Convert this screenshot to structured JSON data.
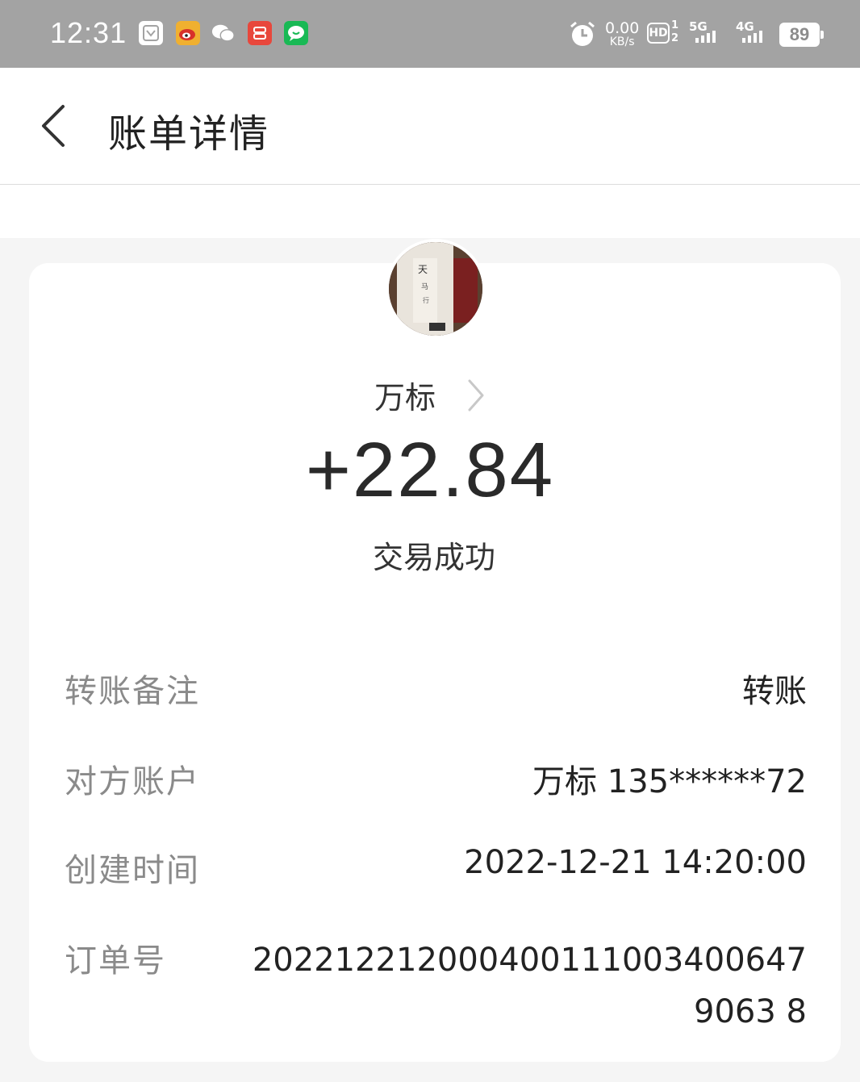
{
  "status_bar": {
    "time": "12:31",
    "net_speed_value": "0.00",
    "net_speed_unit": "KB/s",
    "hd_label": "HD",
    "sim1_label": "1",
    "sim2_label": "2",
    "network1": "5G",
    "network2": "4G",
    "battery": "89",
    "notification_icons": [
      "screenshot-app-icon",
      "weibo-icon",
      "wechat-icon",
      "xiaohongshu-icon",
      "messages-icon"
    ]
  },
  "header": {
    "title": "账单详情",
    "back_icon": "chevron-left-icon"
  },
  "transaction": {
    "payee": "万标",
    "amount": "+22.84",
    "status": "交易成功"
  },
  "details": {
    "note_label": "转账备注",
    "note_value": "转账",
    "account_label": "对方账户",
    "account_value": "万标 135******72",
    "time_label": "创建时间",
    "time_value": "2022-12-21 14:20:00",
    "order_label": "订单号",
    "order_value": "2022122120004001110034006479063 8"
  },
  "colors": {
    "status_bar_bg": "#a3a3a3",
    "page_bg": "#f5f5f5",
    "label_gray": "#8a8a8a",
    "value_dark": "#222222"
  }
}
